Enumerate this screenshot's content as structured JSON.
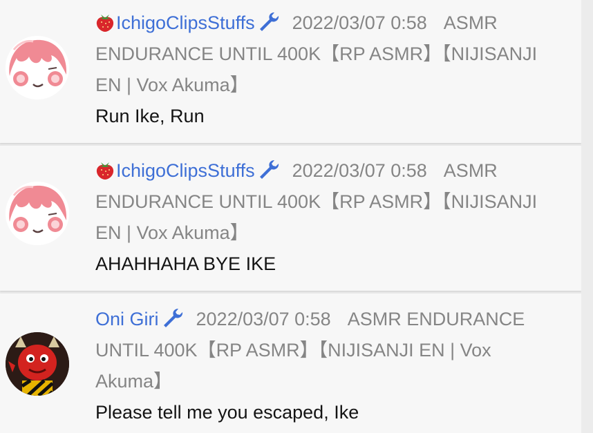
{
  "comments": [
    {
      "author": "IchigoClipsStuffs",
      "has_strawberry": true,
      "date": "2022/03/07 0:58",
      "video_title": "ASMR ENDURANCE UNTIL 400K【RP ASMR】【NIJISANJI EN | Vox Akuma】",
      "message": "Run Ike, Run",
      "avatar": "pink-haired-character-avatar"
    },
    {
      "author": "IchigoClipsStuffs",
      "has_strawberry": true,
      "date": "2022/03/07 0:58",
      "video_title": "ASMR ENDURANCE UNTIL 400K【RP ASMR】【NIJISANJI EN | Vox Akuma】",
      "message": "AHAHHAHA BYE IKE",
      "avatar": "pink-haired-character-avatar"
    },
    {
      "author": "Oni Giri",
      "has_strawberry": false,
      "date": "2022/03/07 0:58",
      "video_title": "ASMR ENDURANCE UNTIL 400K【RP ASMR】【NIJISANJI EN | Vox Akuma】",
      "message": "Please tell me you escaped, Ike",
      "avatar": "red-oni-avatar"
    }
  ],
  "colors": {
    "author": "#3e6fd6",
    "meta": "#858585",
    "message": "#141414",
    "card": "#f7f7f7",
    "background": "#e9e9e9"
  },
  "icons": {
    "badge": "wrench-icon",
    "prefix": "strawberry-icon"
  }
}
